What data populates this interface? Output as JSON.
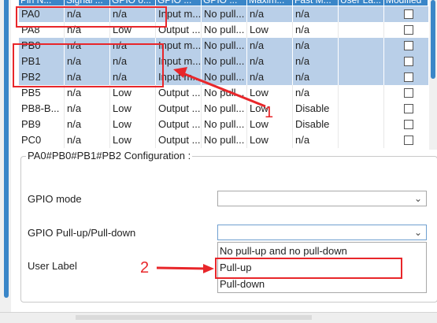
{
  "table": {
    "headers": [
      "Pin N...",
      "Signal ...",
      "GPIO o...",
      "GPIO ...",
      "GPIO ...",
      "Maxim...",
      "Fast M...",
      "User La...",
      "Modified"
    ],
    "rows": [
      {
        "pin": "PA0",
        "signal": "n/a",
        "output": "n/a",
        "mode": "Input m...",
        "pull": "No pull...",
        "speed": "n/a",
        "fast": "n/a",
        "label": "",
        "modified": false,
        "selected": true
      },
      {
        "pin": "PA8",
        "signal": "n/a",
        "output": "Low",
        "mode": "Output ...",
        "pull": "No pull...",
        "speed": "Low",
        "fast": "n/a",
        "label": "",
        "modified": false,
        "selected": false
      },
      {
        "pin": "PB0",
        "signal": "n/a",
        "output": "n/a",
        "mode": "Input m...",
        "pull": "No pull...",
        "speed": "n/a",
        "fast": "n/a",
        "label": "",
        "modified": false,
        "selected": true
      },
      {
        "pin": "PB1",
        "signal": "n/a",
        "output": "n/a",
        "mode": "Input m...",
        "pull": "No pull...",
        "speed": "n/a",
        "fast": "n/a",
        "label": "",
        "modified": false,
        "selected": true
      },
      {
        "pin": "PB2",
        "signal": "n/a",
        "output": "n/a",
        "mode": "Input m...",
        "pull": "No pull...",
        "speed": "n/a",
        "fast": "n/a",
        "label": "",
        "modified": false,
        "selected": true
      },
      {
        "pin": "PB5",
        "signal": "n/a",
        "output": "Low",
        "mode": "Output ...",
        "pull": "No pull...",
        "speed": "Low",
        "fast": "n/a",
        "label": "",
        "modified": false,
        "selected": false
      },
      {
        "pin": "PB8-B...",
        "signal": "n/a",
        "output": "Low",
        "mode": "Output ...",
        "pull": "No pull...",
        "speed": "Low",
        "fast": "Disable",
        "label": "",
        "modified": false,
        "selected": false
      },
      {
        "pin": "PB9",
        "signal": "n/a",
        "output": "Low",
        "mode": "Output ...",
        "pull": "No pull...",
        "speed": "Low",
        "fast": "Disable",
        "label": "",
        "modified": false,
        "selected": false
      },
      {
        "pin": "PC0",
        "signal": "n/a",
        "output": "Low",
        "mode": "Output ...",
        "pull": "No pull...",
        "speed": "Low",
        "fast": "n/a",
        "label": "",
        "modified": false,
        "selected": false
      }
    ]
  },
  "config": {
    "title": "PA0#PB0#PB1#PB2 Configuration :",
    "gpio_mode_label": "GPIO mode",
    "gpio_mode_value": "",
    "pull_label": "GPIO Pull-up/Pull-down",
    "pull_value": "",
    "user_label": "User Label",
    "options": [
      "No pull-up and no pull-down",
      "Pull-up",
      "Pull-down"
    ]
  },
  "annotations": {
    "step1": "1",
    "step2": "2",
    "color": "#e8262a"
  },
  "icons": {
    "dropdown_chevron": "chevron-down-icon",
    "arrow": "red-arrow"
  },
  "colors": {
    "accent": "#3a86c8",
    "selected_row": "#b9cfe8"
  }
}
